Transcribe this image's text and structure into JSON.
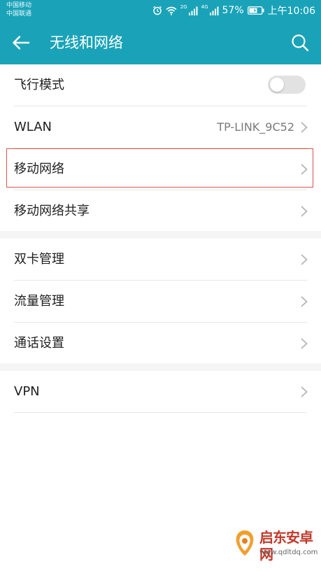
{
  "status_bar": {
    "carrier_1": "中国移动",
    "carrier_2": "中国联通",
    "sim1_tag": "2G",
    "sim2_tag": "4G",
    "battery": "57%",
    "time": "上午10:06"
  },
  "app_bar": {
    "title": "无线和网络"
  },
  "settings": {
    "group1": [
      {
        "label": "飞行模式",
        "type": "toggle",
        "on": false
      },
      {
        "label": "WLAN",
        "value": "TP-LINK_9C52"
      },
      {
        "label": "移动网络"
      },
      {
        "label": "移动网络共享"
      }
    ],
    "group2": [
      {
        "label": "双卡管理"
      },
      {
        "label": "流量管理"
      },
      {
        "label": "通话设置"
      }
    ],
    "group3": [
      {
        "label": "VPN"
      }
    ]
  },
  "watermark": {
    "name": "启东安卓网",
    "url": "www.qdltdq.com"
  },
  "colors": {
    "accent": "#1aa3b8",
    "highlight_border": "#d9534f"
  }
}
